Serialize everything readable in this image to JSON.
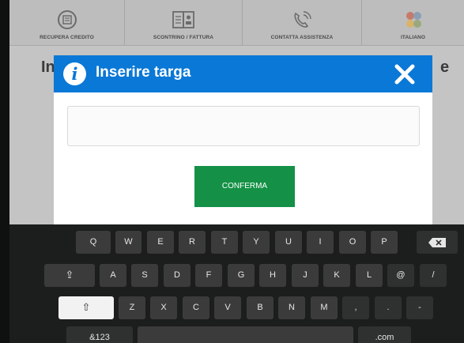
{
  "topbar": {
    "items": [
      {
        "label": "RECUPERA CREDITO",
        "icon": "credit-coin-icon"
      },
      {
        "label": "SCONTRINO / FATTURA",
        "icon": "receipt-icon"
      },
      {
        "label": "CONTATTA ASSISTENZA",
        "icon": "phone-support-icon"
      },
      {
        "label": "ITALIANO",
        "icon": "language-flags-icon"
      }
    ]
  },
  "background": {
    "title_left": "In",
    "title_right": "e"
  },
  "modal": {
    "title": "Inserire targa",
    "input_value": "",
    "confirm_label": "CONFERMA"
  },
  "keyboard": {
    "row1": [
      "Q",
      "W",
      "E",
      "R",
      "T",
      "Y",
      "U",
      "I",
      "O",
      "P"
    ],
    "row2": [
      "A",
      "S",
      "D",
      "F",
      "G",
      "H",
      "J",
      "K",
      "L",
      "@",
      "/"
    ],
    "row3": [
      "Z",
      "X",
      "C",
      "V",
      "B",
      "N",
      "M",
      ",",
      ".",
      "-"
    ],
    "shift_glyph": "⇧",
    "caps_glyph": "⇪",
    "symbols_label": "&123",
    "com_label": ".com"
  },
  "colors": {
    "header_blue": "#0a78d6",
    "confirm_green": "#149146",
    "overlay_gray": "#c4c4c4"
  }
}
